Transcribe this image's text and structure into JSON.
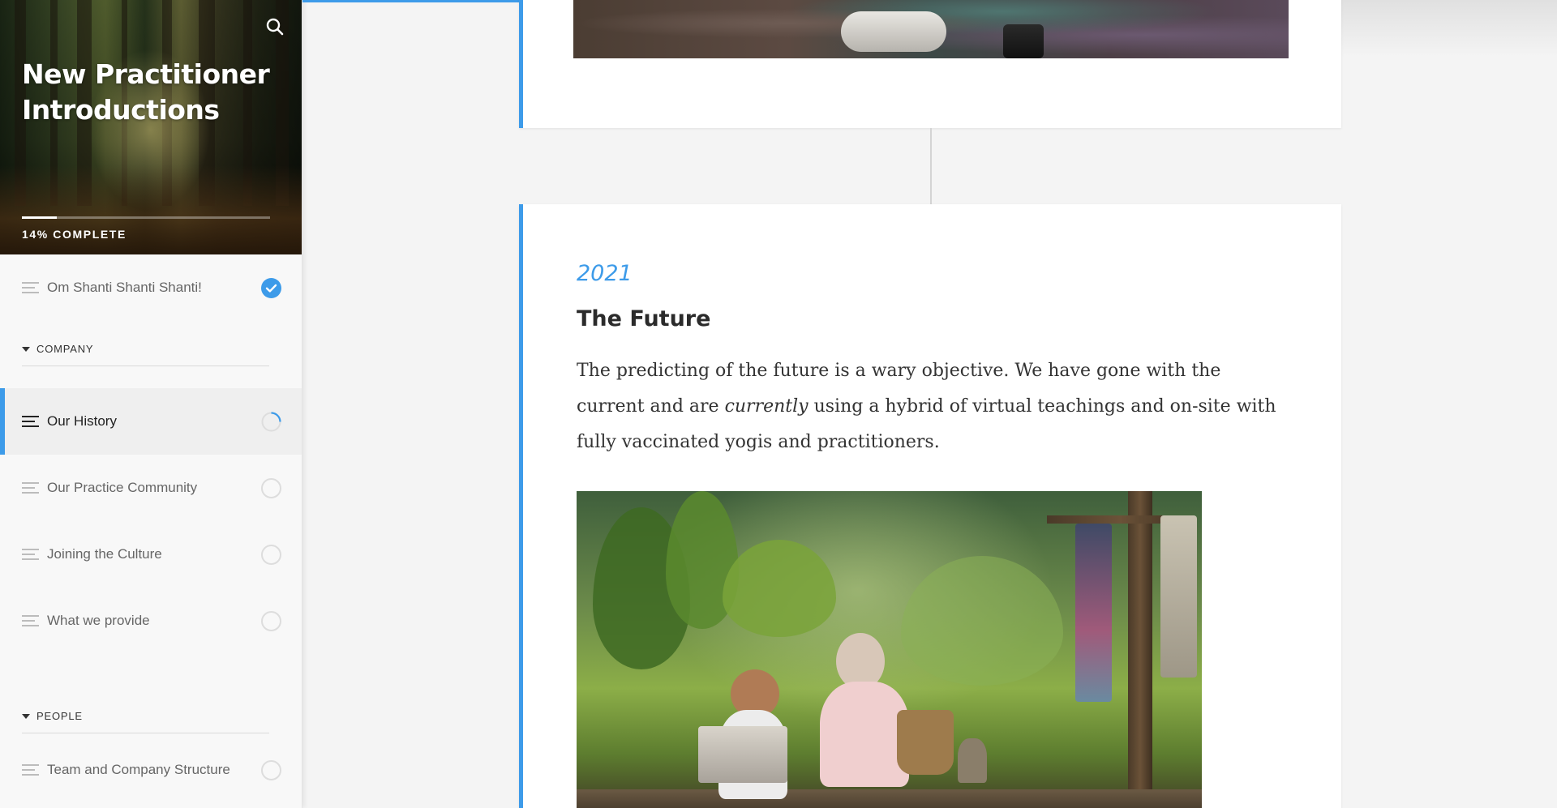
{
  "course": {
    "title": "New Practitioner Introductions",
    "progress_percent": 14,
    "progress_label": "14% COMPLETE"
  },
  "sidebar": {
    "items": [
      {
        "type": "lesson",
        "label": "Om Shanti Shanti Shanti!",
        "status": "complete"
      },
      {
        "type": "section",
        "label": "COMPANY"
      },
      {
        "type": "lesson",
        "label": "Our History",
        "status": "in-progress",
        "active": true
      },
      {
        "type": "lesson",
        "label": "Our Practice Community",
        "status": "not-started"
      },
      {
        "type": "lesson",
        "label": "Joining the Culture",
        "status": "not-started"
      },
      {
        "type": "lesson",
        "label": "What we provide",
        "status": "not-started"
      },
      {
        "type": "section",
        "label": "PEOPLE"
      },
      {
        "type": "lesson",
        "label": "Team and Company Structure",
        "status": "not-started"
      }
    ]
  },
  "icons": {
    "search": "search-icon",
    "lesson": "lines-icon",
    "complete": "check-circle-icon",
    "in_progress": "progress-ring-icon",
    "not_started": "empty-circle-icon",
    "section_toggle": "caret-down-icon"
  },
  "timeline": {
    "entry": {
      "year": "2021",
      "heading": "The Future",
      "body_before": "The predicting of the future is a wary objective. We have gone with the current and are ",
      "body_emphasis": "currently",
      "body_after": " using a hybrid of virtual teachings and on-site with fully vaccinated yogis and practitioners."
    }
  },
  "colors": {
    "accent": "#3d9be9",
    "background": "#f4f4f4",
    "card": "#ffffff"
  }
}
